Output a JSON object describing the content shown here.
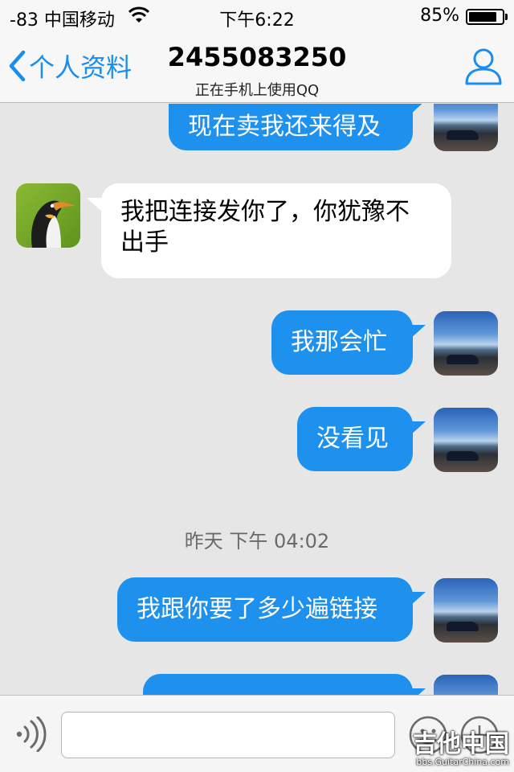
{
  "status_bar": {
    "carrier": "-83 中国移动",
    "time": "下午6:22",
    "battery_text": "85%",
    "battery_level": 0.85
  },
  "nav": {
    "back_label": "个人资料",
    "title": "2455083250",
    "subtitle": "正在手机上使用QQ"
  },
  "messages": [
    {
      "from": "me",
      "text": "现在卖我还来得及"
    },
    {
      "from": "contact",
      "text": "我把连接发你了，你犹豫不出手"
    },
    {
      "from": "me",
      "text": "我那会忙"
    },
    {
      "from": "me",
      "text": "没看见"
    },
    {
      "from": "me",
      "text": "我跟你要了多少遍链接"
    }
  ],
  "timestamp": "昨天 下午 04:02",
  "input": {
    "value": "",
    "placeholder": ""
  },
  "watermark": {
    "line1": "吉他中国",
    "line2": "bbs.GuitarChina.com"
  },
  "colors": {
    "accent": "#1a8df0",
    "bubble_out": "#1e90ee",
    "bubble_in": "#ffffff",
    "background": "#e6e6e6"
  }
}
